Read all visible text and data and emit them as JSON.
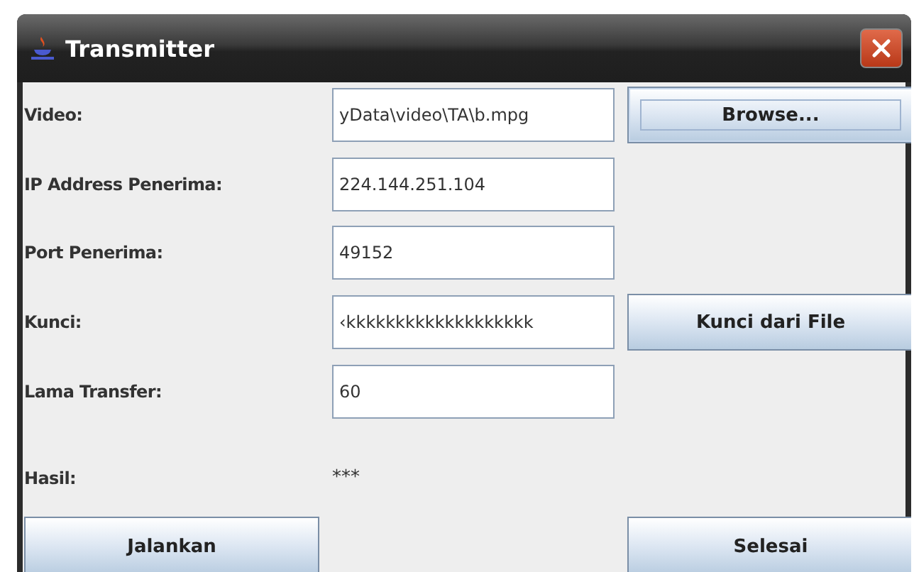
{
  "window": {
    "title": "Transmitter"
  },
  "rows": [
    {
      "label": "Video:",
      "kind": "field",
      "value": "yData\\video\\TA\\b.mpg",
      "button": {
        "label": "Browse...",
        "focused": true
      }
    },
    {
      "label": "IP Address Penerima:",
      "kind": "field",
      "value": "224.144.251.104"
    },
    {
      "label": "Port Penerima:",
      "kind": "field",
      "value": "49152"
    },
    {
      "label": "Kunci:",
      "kind": "field",
      "value": "‹kkkkkkkkkkkkkkkkkkk",
      "button": {
        "label": "Kunci dari File",
        "focused": false
      }
    },
    {
      "label": "Lama Transfer:",
      "kind": "field",
      "value": "60"
    },
    {
      "label": "Hasil:",
      "kind": "text",
      "value": "***"
    }
  ],
  "buttons": [
    {
      "label": "Jalankan"
    },
    {
      "label": "Selesai"
    }
  ]
}
